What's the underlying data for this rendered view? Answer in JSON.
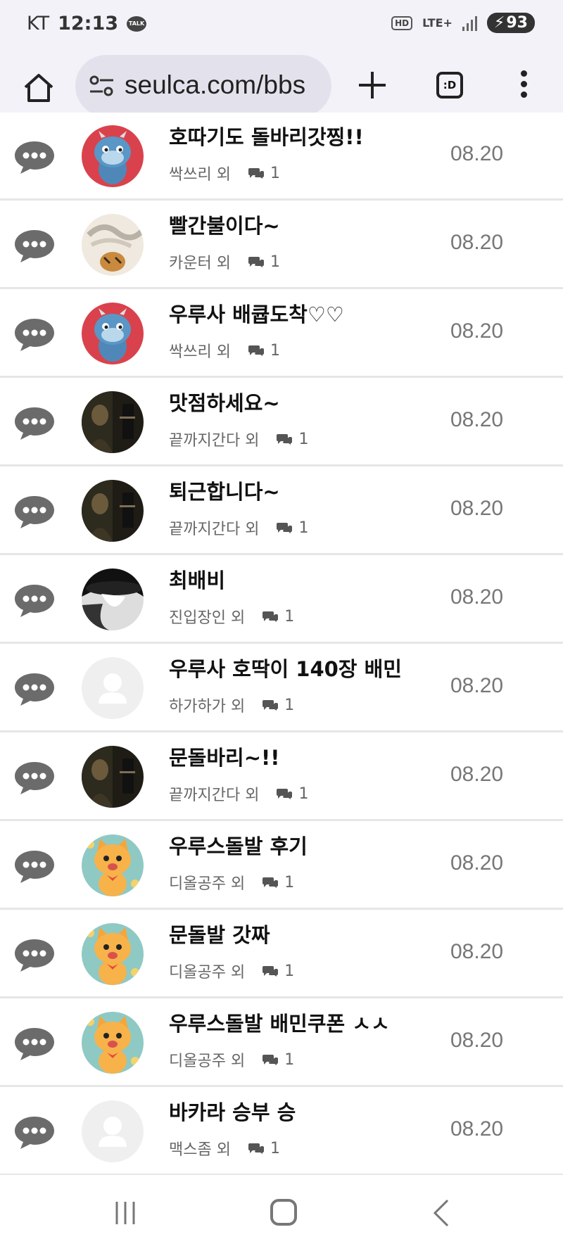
{
  "status_bar": {
    "carrier": "KT",
    "time": "12:13",
    "talk_badge": "TALK",
    "hd_badge": "HD",
    "network": "LTE+",
    "battery": "93"
  },
  "browser": {
    "url": "seulca.com/bbs",
    "tabs_label": ":D"
  },
  "posts": [
    {
      "title": "호따기도 돌바리갓찡!!",
      "author": "싹쓰리 외",
      "comments": "1",
      "date": "08.20",
      "avatar": "dragon"
    },
    {
      "title": "빨간불이다~",
      "author": "카운터 외",
      "comments": "1",
      "date": "08.20",
      "avatar": "tiger-dragon"
    },
    {
      "title": "우루사 배큡도착♡♡",
      "author": "싹쓰리 외",
      "comments": "1",
      "date": "08.20",
      "avatar": "dragon"
    },
    {
      "title": "맛점하세요~",
      "author": "끝까지간다 외",
      "comments": "1",
      "date": "08.20",
      "avatar": "movie"
    },
    {
      "title": "퇴근합니다~",
      "author": "끝까지간다 외",
      "comments": "1",
      "date": "08.20",
      "avatar": "movie"
    },
    {
      "title": "최배비",
      "author": "진입장인 외",
      "comments": "1",
      "date": "08.20",
      "avatar": "bw-hat"
    },
    {
      "title": "우루사 호딱이 140장 배민",
      "author": "하가하가 외",
      "comments": "1",
      "date": "08.20",
      "avatar": "default"
    },
    {
      "title": "문돌바리~!!",
      "author": "끝까지간다 외",
      "comments": "1",
      "date": "08.20",
      "avatar": "movie"
    },
    {
      "title": "우루스돌발 후기",
      "author": "디올공주 외",
      "comments": "1",
      "date": "08.20",
      "avatar": "cat"
    },
    {
      "title": "문돌발 갓짜",
      "author": "디올공주 외",
      "comments": "1",
      "date": "08.20",
      "avatar": "cat"
    },
    {
      "title": "우루스돌발 배민쿠폰 ㅅㅅ",
      "author": "디올공주 외",
      "comments": "1",
      "date": "08.20",
      "avatar": "cat"
    },
    {
      "title": "바카라 승부 승",
      "author": "맥스좀 외",
      "comments": "1",
      "date": "08.20",
      "avatar": "default"
    }
  ],
  "colors": {
    "dragon_bg": "#d9424c",
    "cat_bg": "#8fc9c4",
    "default_avatar": "#efefef"
  }
}
